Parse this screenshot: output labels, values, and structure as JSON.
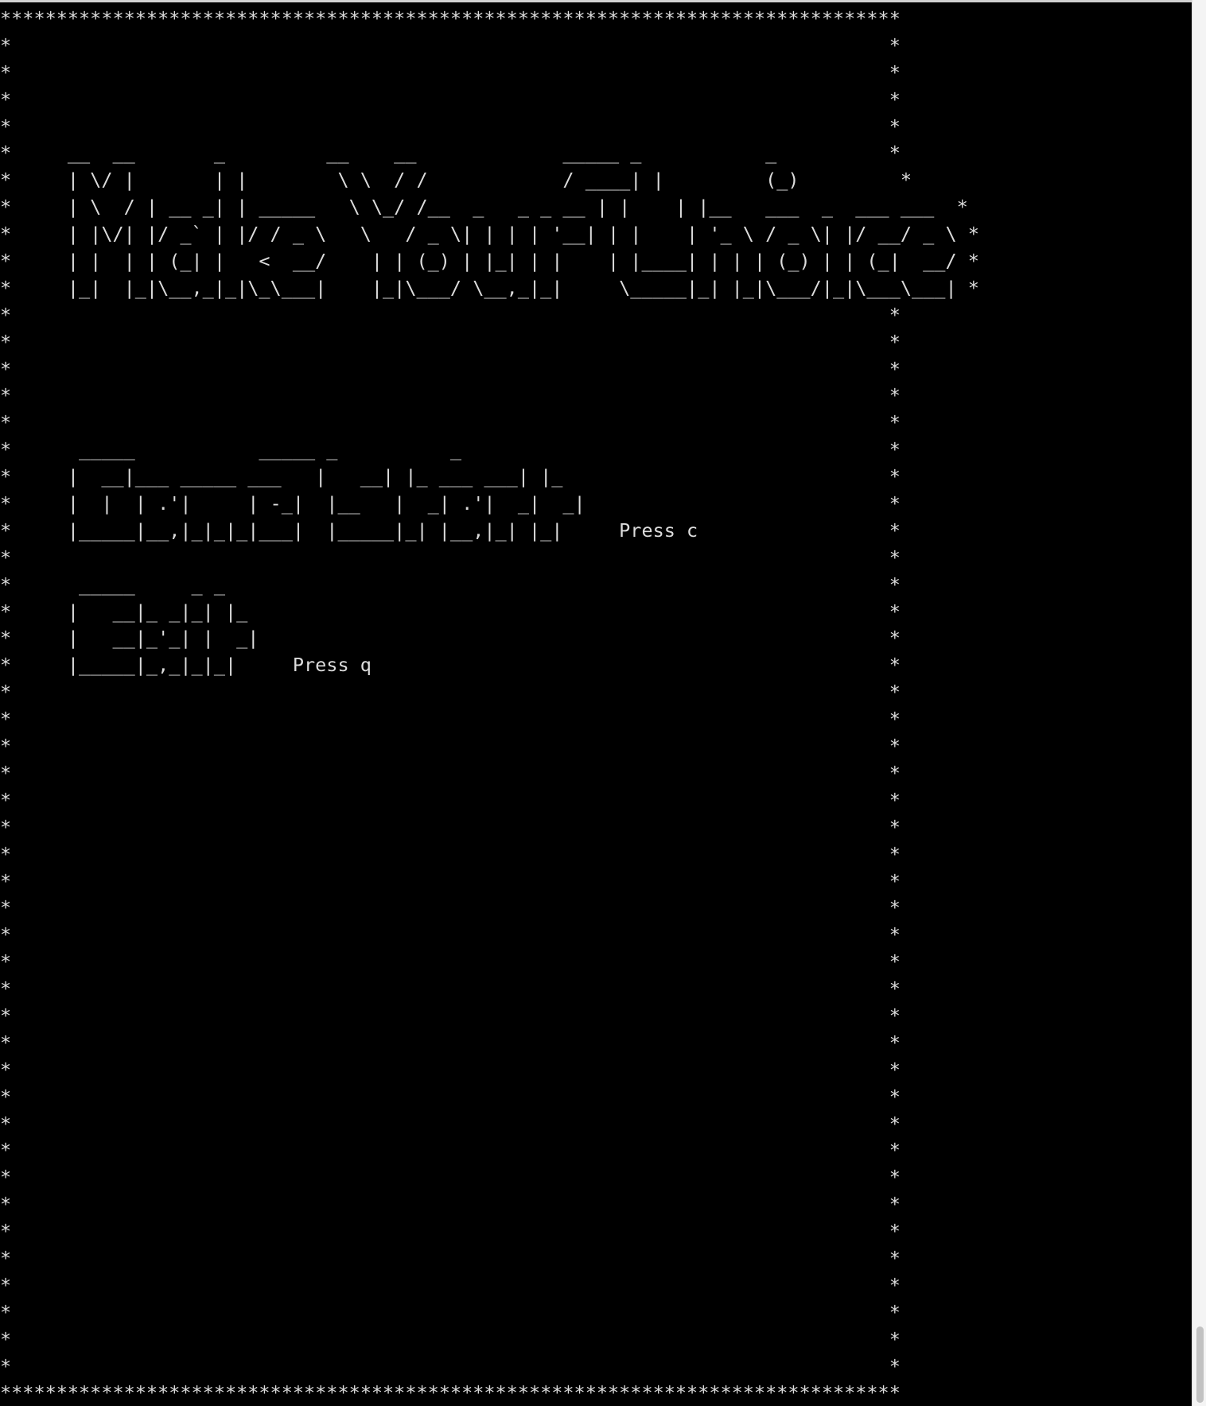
{
  "screen_rows": [
    "********************************************************************************",
    "*                                                                              *",
    "*                                                                              *",
    "*                                                                              *",
    "*                                                                              *",
    "*     __  __       _         __    __             _____ _           _          *",
    "*     | \\/ |       | |        \\ \\  / /            / ____| |         (_)         *",
    "*     | \\  / | __ _| | _____   \\ \\_/ /__  _   _ _ __ | |    | |__   ___  _  ___ ___  *",
    "*     | |\\/| |/ _` | |/ / _ \\   \\   / _ \\| | | | '__| | |    | '_ \\ / _ \\| |/ __/ _ \\ *",
    "*     | |  | | (_| |   <  __/    | | (_) | |_| | |    | |____| | | | (_) | | (_|  __/ *",
    "*     |_|  |_|\\__,_|_|\\_\\___|    |_|\\___/ \\__,_|_|     \\_____|_| |_|\\___/|_|\\___\\___| *",
    "*                                                                              *",
    "*                                                                              *",
    "*                                                                              *",
    "*                                                                              *",
    "*                                                                              *",
    "*      _____           _____ _          _                                      *",
    "*     |  __|___ _____ ___   |   __| |_ ___ ___| |_                             *",
    "*     |  |  | .'|     | -_|  |__   |  _| .'|  _|  _|                           *",
    "*     |_____|__,|_|_|_|___|  |_____|_| |__,|_| |_|     Press c                 *",
    "*                                                                              *",
    "*      _____     _ _                                                           *",
    "*     |   __|_ _|_| |_                                                         *",
    "*     |   __|_'_| |  _|                                                        *",
    "*     |_____|_,_|_|_|     Press q                                              *",
    "*                                                                              *",
    "*                                                                              *",
    "*                                                                              *",
    "*                                                                              *",
    "*                                                                              *",
    "*                                                                              *",
    "*                                                                              *",
    "*                                                                              *",
    "*                                                                              *",
    "*                                                                              *",
    "*                                                                              *",
    "*                                                                              *",
    "*                                                                              *",
    "*                                                                              *",
    "*                                                                              *",
    "*                                                                              *",
    "*                                                                              *",
    "*                                                                              *",
    "*                                                                              *",
    "*                                                                              *",
    "*                                                                              *",
    "*                                                                              *",
    "*                                                                              *",
    "*                                                                              *",
    "*                                                                              *",
    "*                                                                              *",
    "********************************************************************************"
  ],
  "menu": {
    "title": "Make Your Choice",
    "options": [
      {
        "label": "Game Start",
        "hint": "Press c"
      },
      {
        "label": "Exit",
        "hint": "Press q"
      }
    ]
  },
  "colors": {
    "background": "#000000",
    "text": "#dcdcdc"
  }
}
